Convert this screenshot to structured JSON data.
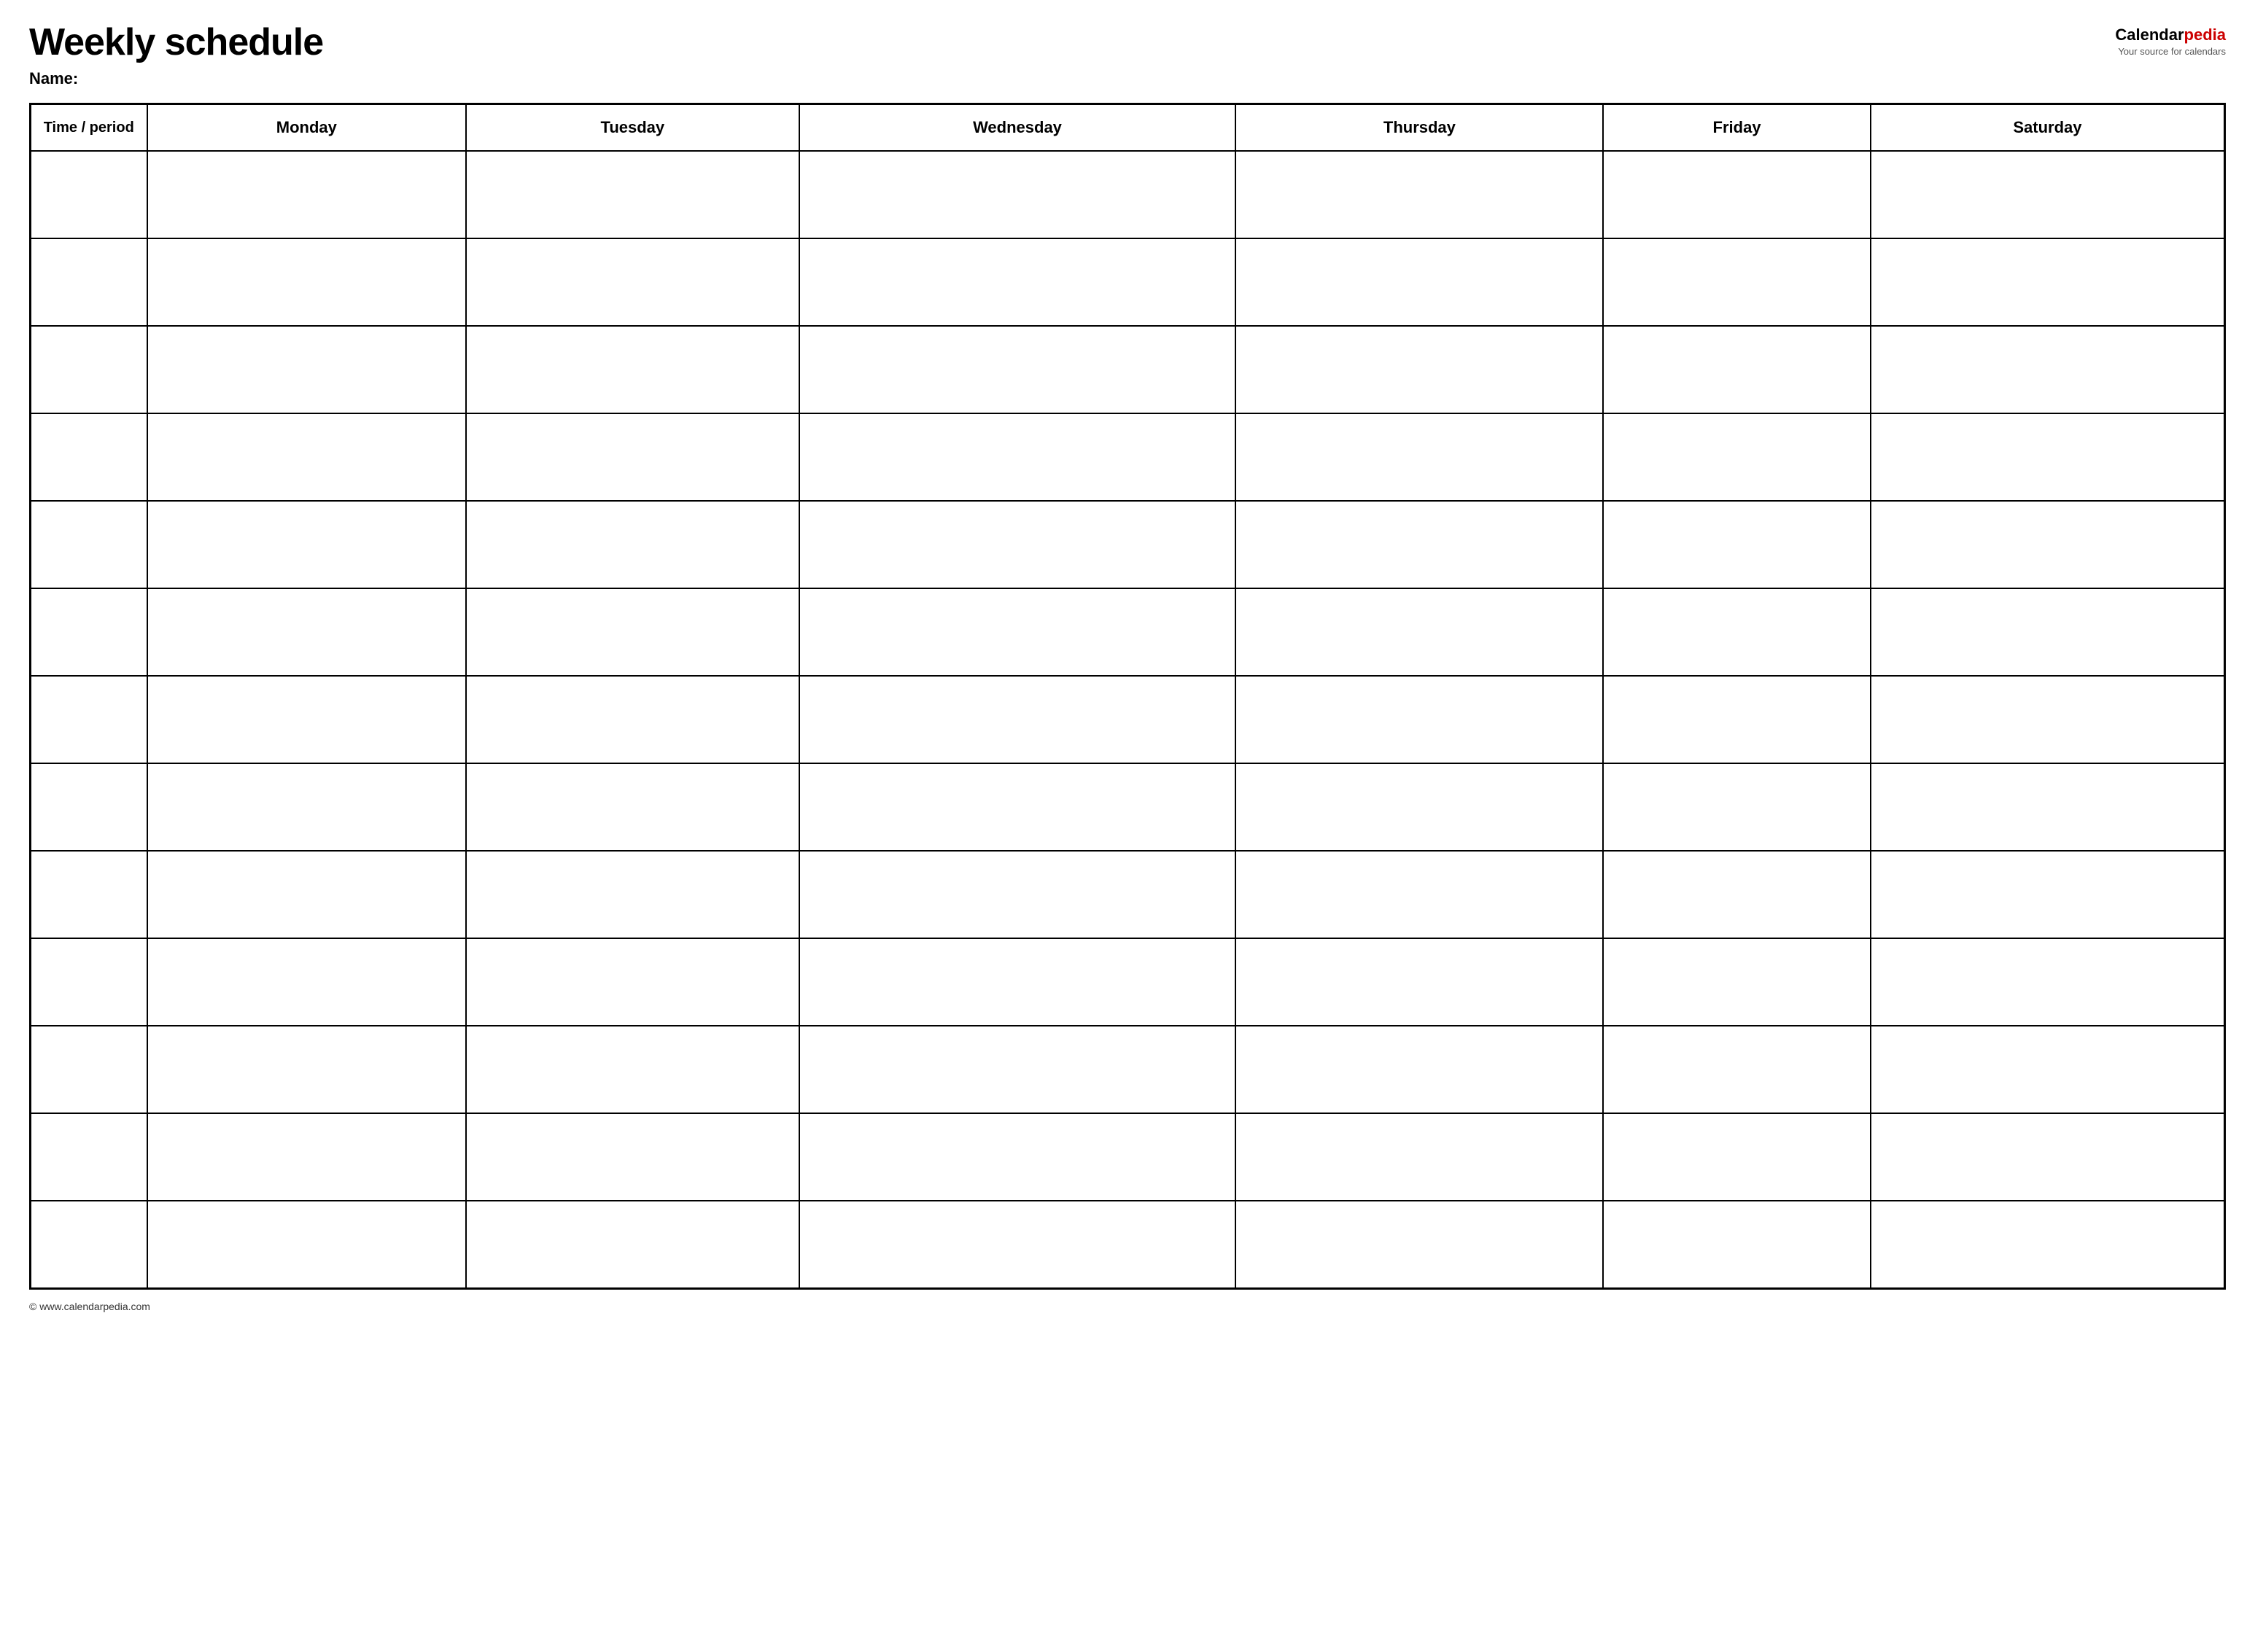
{
  "header": {
    "title": "Weekly schedule",
    "name_label": "Name:",
    "logo_calendar": "Calendar",
    "logo_pedia": "pedia",
    "logo_tagline": "Your source for calendars",
    "website": "© www.calendarpedia.com"
  },
  "table": {
    "headers": [
      {
        "label": "Time / period",
        "key": "time-period"
      },
      {
        "label": "Monday",
        "key": "monday"
      },
      {
        "label": "Tuesday",
        "key": "tuesday"
      },
      {
        "label": "Wednesday",
        "key": "wednesday"
      },
      {
        "label": "Thursday",
        "key": "thursday"
      },
      {
        "label": "Friday",
        "key": "friday"
      },
      {
        "label": "Saturday",
        "key": "saturday"
      }
    ],
    "row_count": 13
  }
}
